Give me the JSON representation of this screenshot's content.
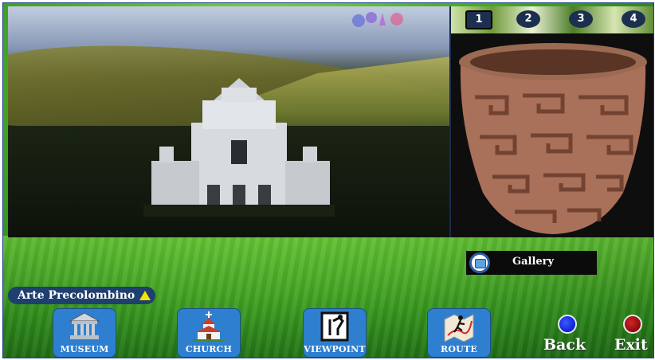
{
  "tabs": [
    {
      "label": "1",
      "active": true
    },
    {
      "label": "2",
      "active": false
    },
    {
      "label": "3",
      "active": false
    },
    {
      "label": "4",
      "active": false
    }
  ],
  "gallery": {
    "label": "Gallery",
    "icon": "camera-icon"
  },
  "section": {
    "label": "Arte Precolombino",
    "icon": "triangle-up-icon"
  },
  "nav": {
    "museum": {
      "label": "MUSEUM",
      "icon": "museum-icon"
    },
    "church": {
      "label": "CHURCH",
      "icon": "church-icon"
    },
    "viewpoint": {
      "label": "VIEWPOINT",
      "icon": "viewpoint-icon"
    },
    "route": {
      "label": "ROUTE",
      "icon": "route-icon"
    }
  },
  "actions": {
    "back": "Back",
    "exit": "Exit"
  },
  "colors": {
    "button_blue": "#2f7fd0",
    "back_circle": "#0b1fd6",
    "exit_circle": "#8d0a0a",
    "label_bar": "#1f3f6e",
    "tab_bg": "#1c2f4e"
  }
}
